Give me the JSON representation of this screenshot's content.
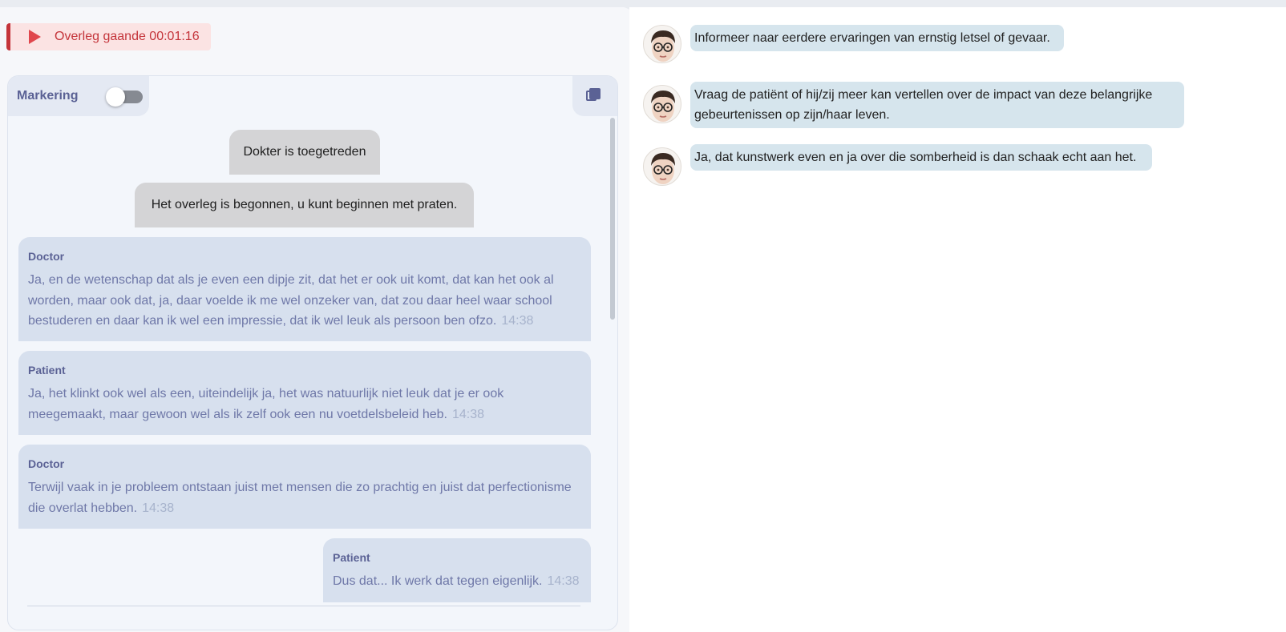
{
  "status": {
    "text": "Overleg gaande 00:01:16",
    "color": "#c4343a"
  },
  "toolbar": {
    "marker_label": "Markering",
    "marker_on": false,
    "copy_icon": "copy-icon"
  },
  "system_messages": [
    "Dokter is toegetreden",
    "Het overleg is begonnen, u kunt beginnen met praten."
  ],
  "messages": [
    {
      "sender": "Doctor",
      "text": "Ja, en de wetenschap dat als je even een dipje zit, dat het er ook uit komt, dat kan het ook al worden, maar ook dat, ja, daar voelde ik me wel onzeker van, dat zou daar heel waar school bestuderen en daar kan ik wel een impressie, dat ik wel leuk als persoon ben ofzo.",
      "time": "14:38"
    },
    {
      "sender": "Patient",
      "text": "Ja, het klinkt ook wel als een, uiteindelijk ja, het was natuurlijk niet leuk dat je er ook meegemaakt, maar gewoon wel als ik zelf ook een nu voetdelsbeleid heb.",
      "time": "14:38"
    },
    {
      "sender": "Doctor",
      "text": "Terwijl vaak in je probleem ontstaan juist met mensen die zo prachtig en juist dat perfectionisme die overlat hebben.",
      "time": "14:38"
    },
    {
      "sender": "Patient",
      "text": "Dus dat... Ik werk dat tegen eigenlijk.",
      "time": "14:38"
    }
  ],
  "suggestions": [
    {
      "avatar": "avatar-icon",
      "text": "Informeer naar eerdere ervaringen van ernstig letsel of gevaar."
    },
    {
      "avatar": "avatar-icon",
      "text": "Vraag de patiënt of hij/zij meer kan vertellen over de impact van deze belangrijke gebeurtenissen op zijn/haar leven."
    },
    {
      "avatar": "avatar-icon",
      "text": "Ja, dat kunstwerk even en ja over die somberheid is dan schaak echt aan het."
    }
  ],
  "colors": {
    "accent": "#5b6295",
    "bubble": "#d7e0ee",
    "suggestion_bubble": "#d6e5ed",
    "timestamp": "#a7b3cc"
  }
}
